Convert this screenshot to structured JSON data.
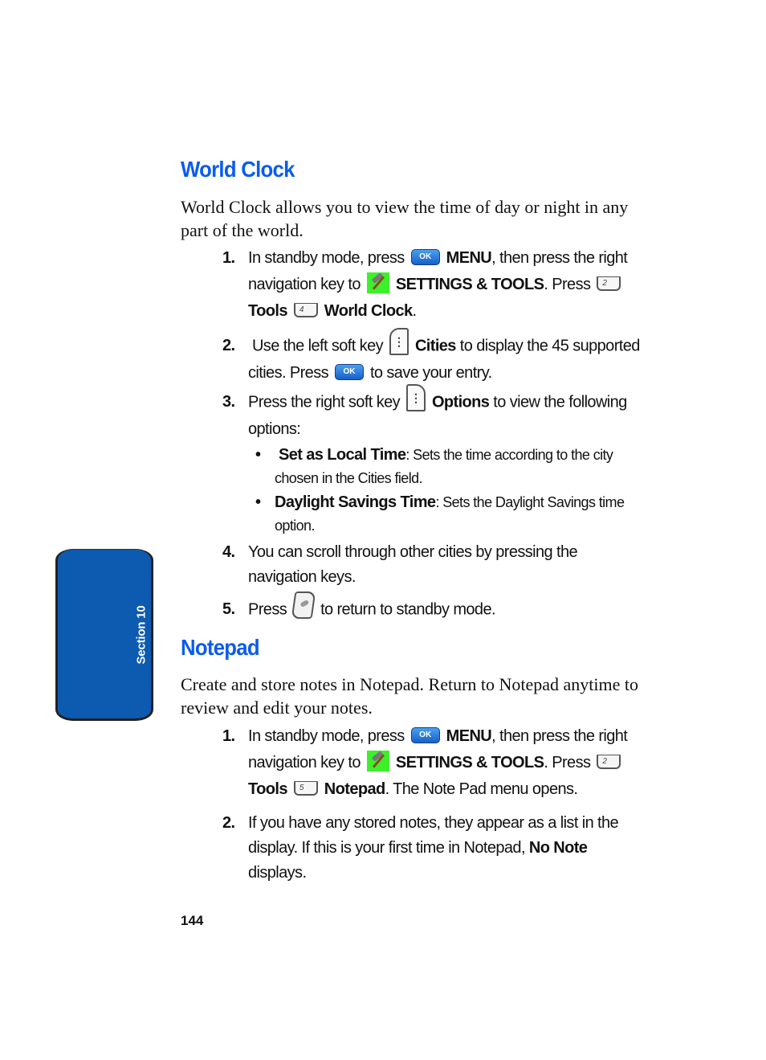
{
  "section_tab": {
    "label": "Section 10",
    "color": "#0c5bb0"
  },
  "world_clock": {
    "title": "World Clock",
    "intro": "World Clock allows you to view the time of day or night in any part of the world.",
    "steps": [
      {
        "num": "1.",
        "parts": {
          "a": "In standby mode, press",
          "ok_key": "OK",
          "menu": "MENU",
          "b": ", then press the right navigation key to",
          "settings": "SETTINGS & TOOLS",
          "c": ". Press",
          "key2": "2",
          "tools": "Tools",
          "key4": "4",
          "target": "World Clock",
          "end": "."
        }
      },
      {
        "num": "2.",
        "parts": {
          "a": "Use the left soft key",
          "cities": "Cities",
          "b": "to display the 45 supported cities. Press",
          "ok_key": "OK",
          "c": "to save your entry."
        }
      },
      {
        "num": "3.",
        "parts": {
          "a": "Press the right soft key",
          "options": "Options",
          "b": "to view the following options:"
        }
      },
      {
        "num": "4.",
        "parts": {
          "a": "You can scroll through other cities by pressing the navigation keys."
        }
      },
      {
        "num": "5.",
        "parts": {
          "a": "Press",
          "b": "to return to standby mode."
        }
      }
    ],
    "options": [
      {
        "term": "Set as Local Time",
        "desc": ": Sets the time according to the city chosen in the Cities field."
      },
      {
        "term": "Daylight Savings Time",
        "desc": ": Sets the Daylight Savings time option."
      }
    ]
  },
  "notepad": {
    "title": "Notepad",
    "intro": "Create and store notes in Notepad. Return to Notepad anytime to review and edit your notes.",
    "steps": [
      {
        "num": "1.",
        "parts": {
          "a": "In standby mode, press",
          "ok_key": "OK",
          "menu": "MENU",
          "b": ", then press the right navigation key to",
          "settings": "SETTINGS & TOOLS",
          "c": ". Press",
          "key2": "2",
          "tools": "Tools",
          "key5": "5",
          "target": "Notepad",
          "end": ". The Note Pad menu opens."
        }
      },
      {
        "num": "2.",
        "parts": {
          "a": "If you have any stored notes, they appear as a list in the display. If this is your first time in Notepad,",
          "no_note": "No Note",
          "b": "displays."
        }
      }
    ]
  },
  "page_number": "144"
}
